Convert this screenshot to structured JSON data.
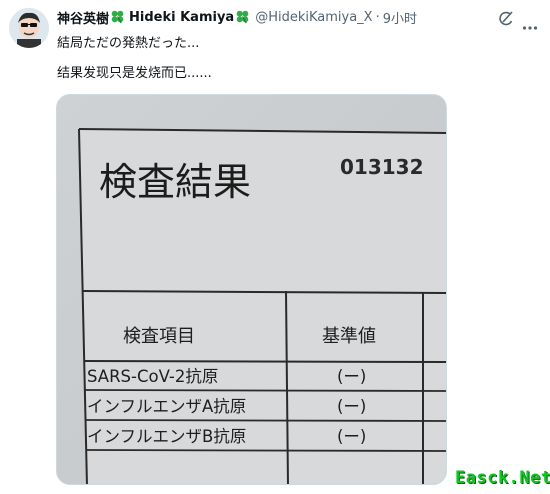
{
  "tweet": {
    "display_name_jp": "神谷英樹",
    "display_name_en": "Hideki Kamiya",
    "handle": "@HidekiKamiya_X",
    "separator": "·",
    "timestamp": "9小时",
    "original_text": "結局ただの発熱だった...",
    "translated_text": "结果发现只是发烧而已......"
  },
  "icons": {
    "emoji": "four-leaf-clover-icon",
    "grok": "grok-icon",
    "more": "more-dots-icon",
    "avatar": "avatar-icon"
  },
  "document": {
    "title": "検査結果",
    "number": "013132",
    "table_header": [
      "検査項目",
      "基準値"
    ],
    "rows": [
      {
        "item": "SARS-CoV-2抗原",
        "value": "(ー)"
      },
      {
        "item": "インフルエンザA抗原",
        "value": "(ー)"
      },
      {
        "item": "インフルエンザB抗原",
        "value": "(ー)"
      }
    ]
  },
  "watermark": "Easck.Net",
  "colors": {
    "text_primary": "#0f1419",
    "text_secondary": "#536471",
    "clover": "#2fae48",
    "watermark": "#11c522"
  }
}
